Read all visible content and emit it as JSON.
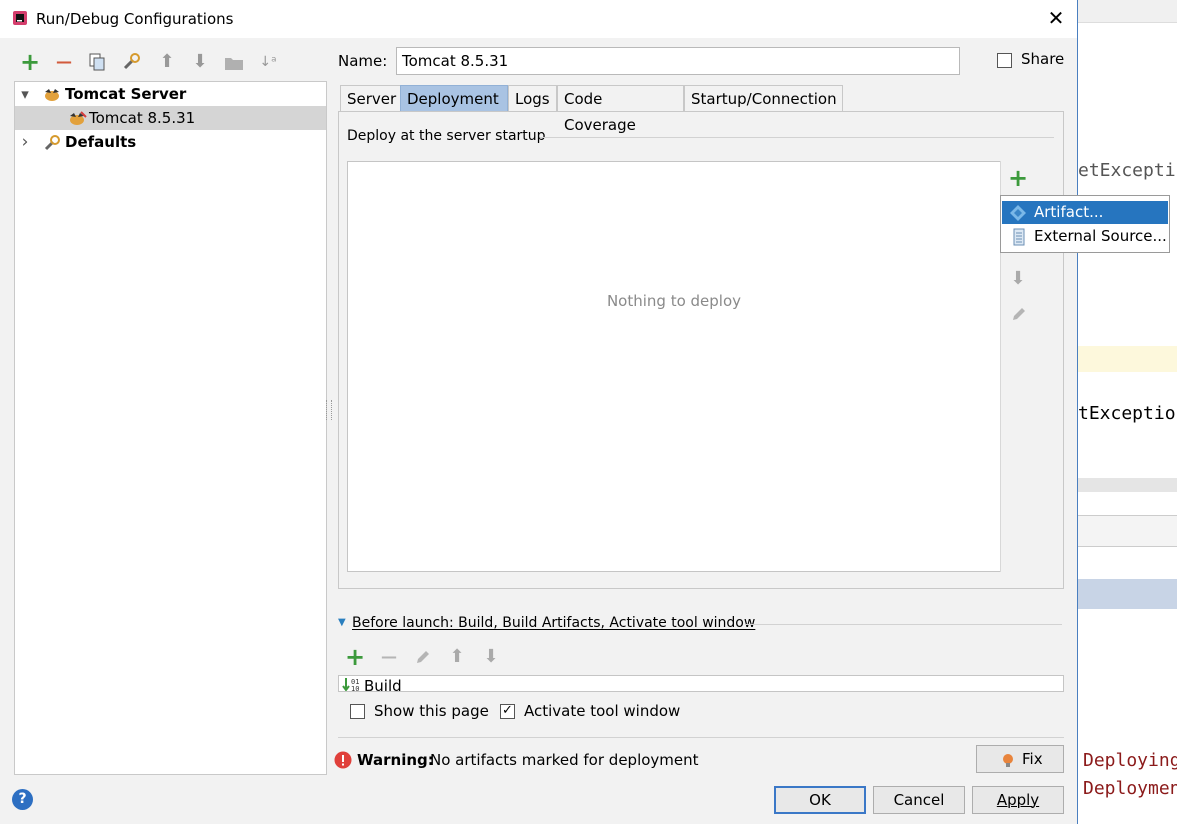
{
  "background_editor": {
    "line1": "etExcepti",
    "line2": "tExceptio",
    "line3": "Deploying",
    "line4": "Deploymen"
  },
  "dialog": {
    "title": "Run/Debug Configurations",
    "close_glyph": "✕",
    "help_glyph": "?"
  },
  "toolbar": {
    "add_glyph": "+",
    "remove_glyph": "—",
    "up_glyph": "⬆",
    "down_glyph": "⬇",
    "sort_glyph": "↓ᵃ"
  },
  "tree": {
    "items": [
      {
        "label": "Tomcat Server",
        "expander": "▾"
      },
      {
        "label": "Tomcat 8.5.31"
      },
      {
        "label": "Defaults",
        "expander": "›"
      }
    ]
  },
  "name_field": {
    "label": "Name:",
    "value": "Tomcat 8.5.31"
  },
  "share": {
    "label": "Share",
    "checked": false
  },
  "tabs": [
    {
      "label": "Server"
    },
    {
      "label": "Deployment",
      "active": true
    },
    {
      "label": "Logs"
    },
    {
      "label": "Code Coverage"
    },
    {
      "label": "Startup/Connection"
    }
  ],
  "deployment": {
    "section_title": "Deploy at the server startup",
    "empty_text": "Nothing to deploy",
    "add_glyph": "+",
    "down_glyph": "⬇",
    "popup": [
      {
        "label": "Artifact...",
        "selected": true
      },
      {
        "label": "External Source..."
      }
    ]
  },
  "before_launch": {
    "title": "Before launch: Build, Build Artifacts, Activate tool window",
    "add_glyph": "+",
    "remove_glyph": "—",
    "up_glyph": "⬆",
    "down_glyph": "⬇",
    "items": [
      {
        "label": "Build"
      }
    ],
    "show_this_page": {
      "label": "Show this page",
      "checked": false
    },
    "activate_tool_window": {
      "label": "Activate tool window",
      "checked": true
    }
  },
  "warning": {
    "bold": "Warning:",
    "text": "No artifacts marked for deployment",
    "fix_label": "Fix"
  },
  "buttons": {
    "ok": "OK",
    "cancel": "Cancel",
    "apply": "Apply"
  },
  "colors": {
    "accent": "#2675bf",
    "tab_active": "#a9c3e3",
    "add_green": "#3c9a3c",
    "remove_red": "#d25a3c"
  }
}
